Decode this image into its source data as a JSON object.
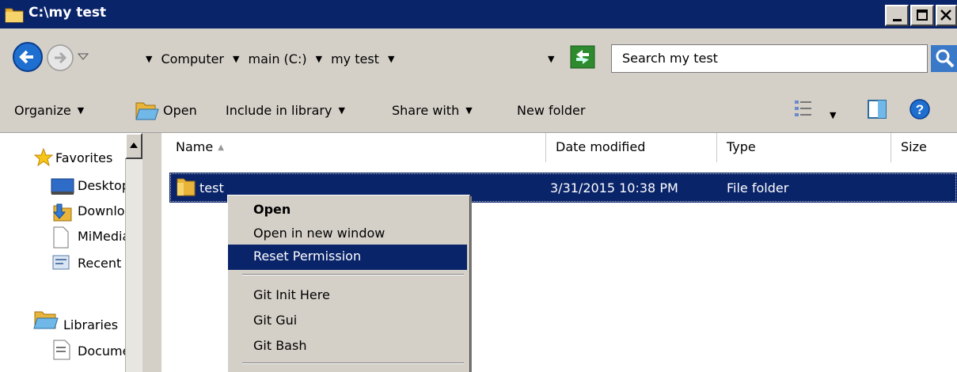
{
  "window": {
    "title": "C:\\my test",
    "controls": [
      "minimize",
      "maximize",
      "close"
    ]
  },
  "address": {
    "breadcrumb": [
      "Computer",
      "main (C:)",
      "my test"
    ],
    "search_placeholder": "Search my test"
  },
  "toolbar": {
    "organize": "Organize",
    "open": "Open",
    "include_in_library": "Include in library",
    "share_with": "Share with",
    "new_folder": "New folder"
  },
  "nav": {
    "favorites": "Favorites",
    "desktop": "Desktop",
    "downloads": "Downloads",
    "mimedia": "MiMedia",
    "recent": "Recent Places",
    "libraries": "Libraries",
    "documents": "Documents"
  },
  "columns": {
    "name": "Name",
    "date_modified": "Date modified",
    "type": "Type",
    "size": "Size"
  },
  "files": [
    {
      "name": "test",
      "date_modified": "3/31/2015 10:38 PM",
      "type": "File folder",
      "size": ""
    }
  ],
  "context_menu": {
    "open": "Open",
    "open_new_window": "Open in new window",
    "reset_permission": "Reset Permission",
    "git_init": "Git Init Here",
    "git_gui": "Git Gui",
    "git_bash": "Git Bash"
  },
  "colors": {
    "titlebar": "#0a246a",
    "selection": "#0a246a",
    "chrome": "#d4d0c8",
    "folder": "#e8b53a"
  }
}
